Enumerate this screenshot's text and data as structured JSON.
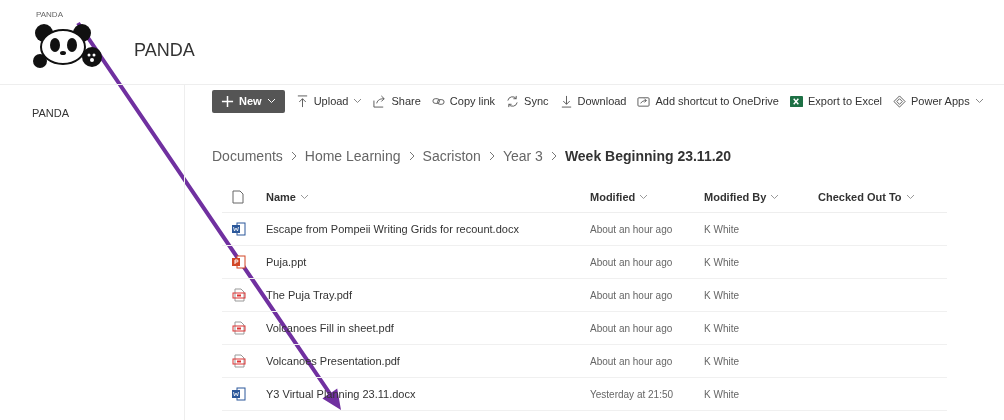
{
  "site": {
    "small_label": "PANDA",
    "title": "PANDA"
  },
  "sidebar": {
    "items": [
      {
        "label": "PANDA"
      }
    ]
  },
  "toolbar": [
    {
      "kind": "new",
      "label": "New"
    },
    {
      "kind": "upload",
      "label": "Upload"
    },
    {
      "kind": "share",
      "label": "Share"
    },
    {
      "kind": "link",
      "label": "Copy link"
    },
    {
      "kind": "sync",
      "label": "Sync"
    },
    {
      "kind": "download",
      "label": "Download"
    },
    {
      "kind": "shortcut",
      "label": "Add shortcut to OneDrive"
    },
    {
      "kind": "excel",
      "label": "Export to Excel"
    },
    {
      "kind": "powerapps",
      "label": "Power Apps"
    }
  ],
  "breadcrumb": [
    "Documents",
    "Home Learning",
    "Sacriston",
    "Year 3",
    "Week Beginning 23.11.20"
  ],
  "table": {
    "columns": [
      "Name",
      "Modified",
      "Modified By",
      "Checked Out To"
    ],
    "rows": [
      {
        "kind": "word",
        "name": "Escape from Pompeii Writing Grids for recount.docx",
        "modified": "About an hour ago",
        "modified_by": "K White"
      },
      {
        "kind": "powerpoint",
        "name": "Puja.ppt",
        "modified": "About an hour ago",
        "modified_by": "K White"
      },
      {
        "kind": "pdf",
        "name": "The Puja Tray.pdf",
        "modified": "About an hour ago",
        "modified_by": "K White"
      },
      {
        "kind": "pdf",
        "name": "Volcanoes Fill in sheet.pdf",
        "modified": "About an hour ago",
        "modified_by": "K White"
      },
      {
        "kind": "pdf",
        "name": "Volcanoes Presentation.pdf",
        "modified": "About an hour ago",
        "modified_by": "K White"
      },
      {
        "kind": "word",
        "name": "Y3 Virtual Planning 23.11.docx",
        "modified": "Yesterday at 21:50",
        "modified_by": "K White"
      }
    ]
  }
}
